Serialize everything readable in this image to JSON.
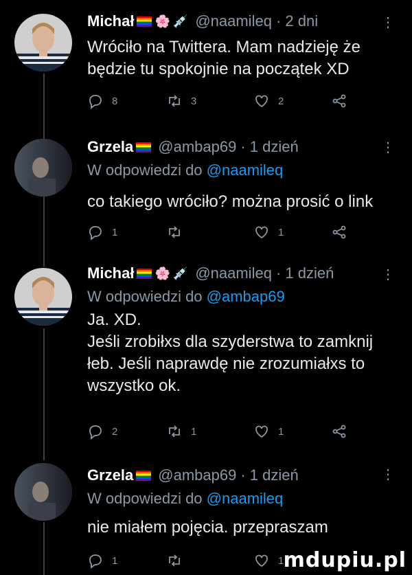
{
  "tweets": [
    {
      "name": "Michał",
      "handle": "@naamileq",
      "time": "· 2 dni",
      "reply_prefix": "",
      "reply_handle": "",
      "text": "Wróciło na Twittera. Mam nadzieję że\nbędzie tu spokojnie na początek XD",
      "counts": {
        "reply": "8",
        "retweet": "3",
        "like": "2"
      }
    },
    {
      "name": "Grzela",
      "handle": "@ambap69",
      "time": "· 1 dzień",
      "reply_prefix": "W odpowiedzi do ",
      "reply_handle": "@naamileq",
      "text": "co takiego wróciło? można prosić o link",
      "counts": {
        "reply": "1",
        "retweet": "",
        "like": "1"
      }
    },
    {
      "name": "Michał",
      "handle": "@naamileq",
      "time": "· 1 dzień",
      "reply_prefix": "W odpowiedzi do ",
      "reply_handle": "@ambap69",
      "text": "Ja. XD.\nJeśli zrobiłxs dla szyderstwa to zamknij\nłeb. Jeśli naprawdę nie zrozumiałxs to\nwszystko ok.",
      "counts": {
        "reply": "2",
        "retweet": "1",
        "like": "1"
      }
    },
    {
      "name": "Grzela",
      "handle": "@ambap69",
      "time": "· 1 dzień",
      "reply_prefix": "W odpowiedzi do ",
      "reply_handle": "@naamileq",
      "text": "nie miałem pojęcia. przepraszam",
      "counts": {
        "reply": "1",
        "retweet": "",
        "like": "1"
      }
    }
  ],
  "icons": {
    "more": "more-options-icon",
    "reply": "reply-icon",
    "retweet": "retweet-icon",
    "like": "heart-icon",
    "share": "share-icon",
    "flag": "rainbow-flag-icon",
    "flower": "flower-emoji-icon",
    "syringe": "syringe-emoji-icon"
  },
  "emoji": {
    "flower": "🌸",
    "syringe": "💉"
  },
  "colors": {
    "background": "#000000",
    "text": "#e7e9ea",
    "muted": "#8b98a5",
    "link": "#1d9bf0"
  },
  "watermark": "mdupiu.pl"
}
